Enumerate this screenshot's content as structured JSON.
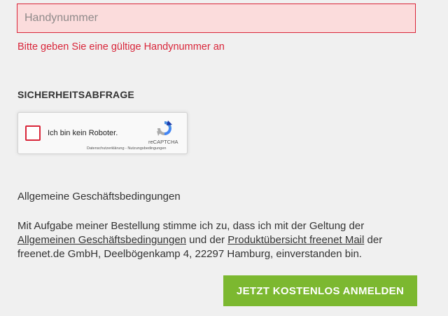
{
  "phone": {
    "placeholder": "Handynummer",
    "value": "",
    "error": "Bitte geben Sie eine gültige Handynummer an"
  },
  "security": {
    "heading": "SICHERHEITSABFRAGE",
    "captcha_label": "Ich bin kein Roboter.",
    "captcha_brand": "reCAPTCHA",
    "privacy_link": "Datenschutzerklärung",
    "separator": " - ",
    "terms_link": "Nutzungsbedingungen"
  },
  "agb": {
    "title": "Allgemeine Geschäftsbedingungen",
    "text_part1": "Mit Aufgabe meiner Bestellung stimme ich zu, dass ich mit der Geltung der ",
    "link1": "Allgemeinen Geschäftsbedingungen",
    "text_part2": " und der ",
    "link2": "Produktübersicht freenet Mail",
    "text_part3": " der freenet.de GmbH, Deelbögenkamp 4, 22297 Hamburg, einverstanden bin."
  },
  "submit_label": "JETZT KOSTENLOS ANMELDEN",
  "colors": {
    "error_red": "#d9263a",
    "input_error_bg": "#fbdcdc",
    "submit_green": "#7cb830",
    "background": "#f0f0f0"
  }
}
